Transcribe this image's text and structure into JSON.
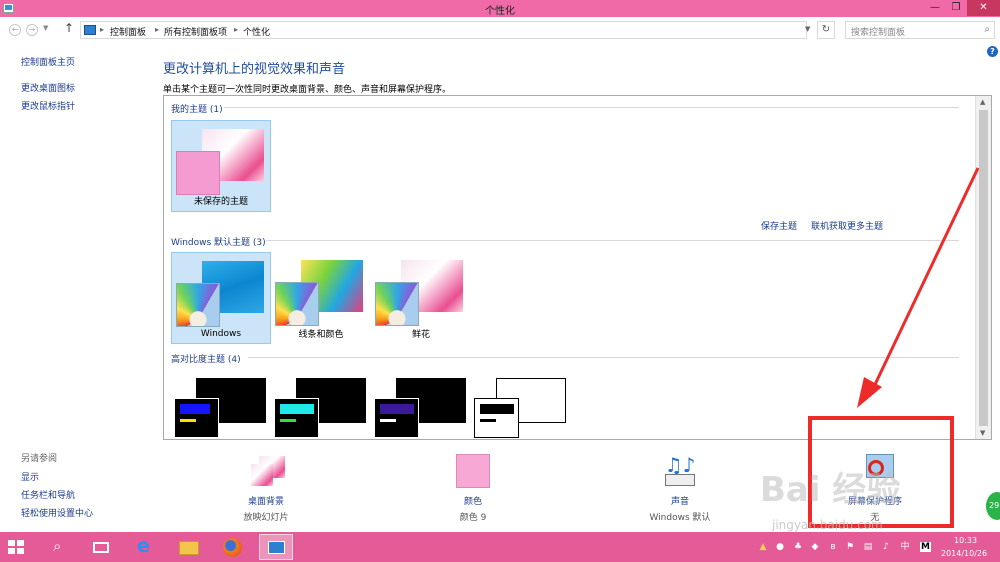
{
  "window": {
    "title": "个性化",
    "min": "—",
    "max": "❐",
    "close": "✕"
  },
  "address": {
    "crumbs": [
      "控制面板",
      "所有控制面板项",
      "个性化"
    ],
    "search_placeholder": "搜索控制面板"
  },
  "sidebar": {
    "links": [
      "控制面板主页",
      "更改桌面图标",
      "更改鼠标指针"
    ],
    "see_also_heading": "另请参阅",
    "see_also": [
      "显示",
      "任务栏和导航",
      "轻松使用设置中心"
    ]
  },
  "main": {
    "title": "更改计算机上的视觉效果和声音",
    "description": "单击某个主题可一次性同时更改桌面背景、颜色、声音和屏幕保护程序。"
  },
  "themes": {
    "my_group": "我的主题 (1)",
    "unsaved_label": "未保存的主题",
    "save_link": "保存主题",
    "online_link": "联机获取更多主题",
    "default_group": "Windows 默认主题 (3)",
    "default_items": [
      "Windows",
      "线条和颜色",
      "鲜花"
    ],
    "hc_group": "高对比度主题 (4)"
  },
  "bottom": {
    "background_label": "桌面背景",
    "background_sub": "放映幻灯片",
    "color_label": "颜色",
    "color_sub": "颜色 9",
    "sound_label": "声音",
    "sound_sub": "Windows 默认",
    "screensaver_label": "屏幕保护程序",
    "screensaver_sub": "无"
  },
  "taskbar": {
    "time": "10:33",
    "date": "2014/10/26",
    "ime_lang": "中",
    "ime_mode": "M"
  },
  "overlay": {
    "watermark": "Bai 经验",
    "watermark_sub": "jingyan.baidu.com",
    "badge": "29"
  },
  "colors": {
    "accent": "#f06aa7",
    "taskbar": "#e45b97",
    "link": "#1a3c8e",
    "highlight": "#ee2b2b"
  }
}
